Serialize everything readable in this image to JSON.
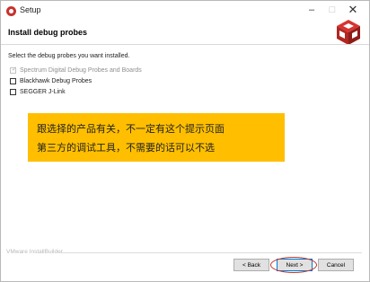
{
  "window": {
    "title": "Setup",
    "minimize_glyph": "–",
    "maximize_glyph": "□",
    "close_glyph": "✕"
  },
  "header": {
    "title": "Install debug probes",
    "logo_icon": "bitrock-cube-logo-icon",
    "accent_color": "#c9312d"
  },
  "main": {
    "instruction": "Select the debug probes you want installed.",
    "options": [
      {
        "label": "Spectrum Digital Debug Probes and Boards",
        "checked": true,
        "enabled": false
      },
      {
        "label": "Blackhawk Debug Probes",
        "checked": false,
        "enabled": true
      },
      {
        "label": "SEGGER J-Link",
        "checked": false,
        "enabled": true
      }
    ]
  },
  "annotation": {
    "line1": "跟选择的产品有关，不一定有这个提示页面",
    "line2": "第三方的调试工具，不需要的话可以不选",
    "background": "#ffbf00"
  },
  "footer": {
    "brand": "VMware InstallBuilder",
    "back_label": "< Back",
    "next_label": "Next >",
    "cancel_label": "Cancel",
    "highlight_color": "#c0392b"
  }
}
